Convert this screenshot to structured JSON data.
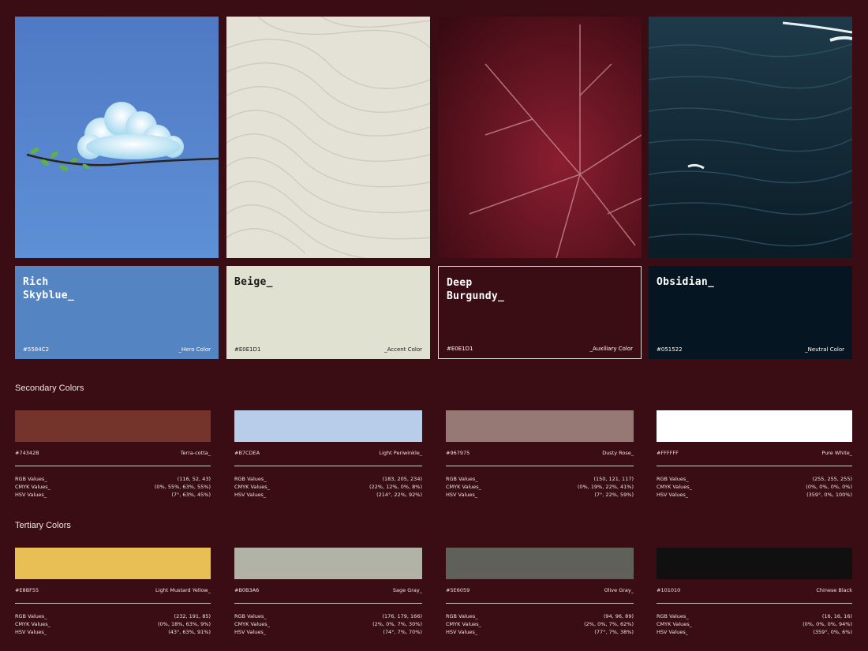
{
  "primary": [
    {
      "name": "Rich\nSkyblue_",
      "hex": "#5584C2",
      "role": "_Hero Color",
      "photo": "cloud-on-branch",
      "color": "#5584C2",
      "text_color": "#ffffff"
    },
    {
      "name": "Beige_",
      "hex": "#E0E1D1",
      "role": "_Accent Color",
      "photo": "sand-texture",
      "color": "#E0E1D1",
      "text_color": "#1a1a1a"
    },
    {
      "name": "Deep\nBurgundy_",
      "hex": "#E0E1D1",
      "role": "_Auxiliary Color",
      "photo": "burgundy-leaf",
      "color": "#3a0c14",
      "text_color": "#ffffff"
    },
    {
      "name": "Obsidian_",
      "hex": "#051522",
      "role": "_Neutral Color",
      "photo": "dark-ocean",
      "color": "#051522",
      "text_color": "#ffffff"
    }
  ],
  "secondary": {
    "title": "Secondary Colors",
    "items": [
      {
        "hex": "#74342B",
        "name": "Terra-cotta_",
        "color": "#74342B",
        "rgb": "(116, 52, 43)",
        "cmyk": "(0%, 55%, 63%, 55%)",
        "hsv": "(7°, 63%, 45%)"
      },
      {
        "hex": "#B7CDEA",
        "name": "Light Periwinkle_",
        "color": "#B7CDEA",
        "rgb": "(183, 205, 234)",
        "cmyk": "(22%, 12%, 0%, 8%)",
        "hsv": "(214°, 22%, 92%)"
      },
      {
        "hex": "#967975",
        "name": "Dusty Rose_",
        "color": "#967975",
        "rgb": "(150, 121, 117)",
        "cmyk": "(0%, 19%, 22%, 41%)",
        "hsv": "(7°, 22%, 59%)"
      },
      {
        "hex": "#FFFFFF",
        "name": "Pure White_",
        "color": "#FFFFFF",
        "rgb": "(255, 255, 255)",
        "cmyk": "(0%, 0%, 0%, 0%)",
        "hsv": "(359°, 0%, 100%)"
      }
    ]
  },
  "tertiary": {
    "title": "Tertiary Colors",
    "items": [
      {
        "hex": "#E8BF55",
        "name": "Light Mustard Yellow_",
        "color": "#E8BF55",
        "rgb": "(232, 191, 85)",
        "cmyk": "(0%, 18%, 63%, 9%)",
        "hsv": "(43°, 63%, 91%)"
      },
      {
        "hex": "#B0B3A6",
        "name": "Sage Gray_",
        "color": "#B0B3A6",
        "rgb": "(176, 179, 166)",
        "cmyk": "(2%, 0%, 7%, 30%)",
        "hsv": "(74°, 7%, 70%)"
      },
      {
        "hex": "#5E6059",
        "name": "Olive Gray_",
        "color": "#5E6059",
        "rgb": "(94, 96, 89)",
        "cmyk": "(2%, 0%, 7%, 62%)",
        "hsv": "(77°, 7%, 38%)"
      },
      {
        "hex": "#101010",
        "name": "Chinese Black",
        "color": "#101010",
        "rgb": "(16, 16, 16)",
        "cmyk": "(0%, 0%, 0%, 94%)",
        "hsv": "(359°, 0%, 6%)"
      }
    ]
  },
  "labels": {
    "rgb": "RGB Values_",
    "cmyk": "CMYK Values_",
    "hsv": "HSV Values_"
  }
}
